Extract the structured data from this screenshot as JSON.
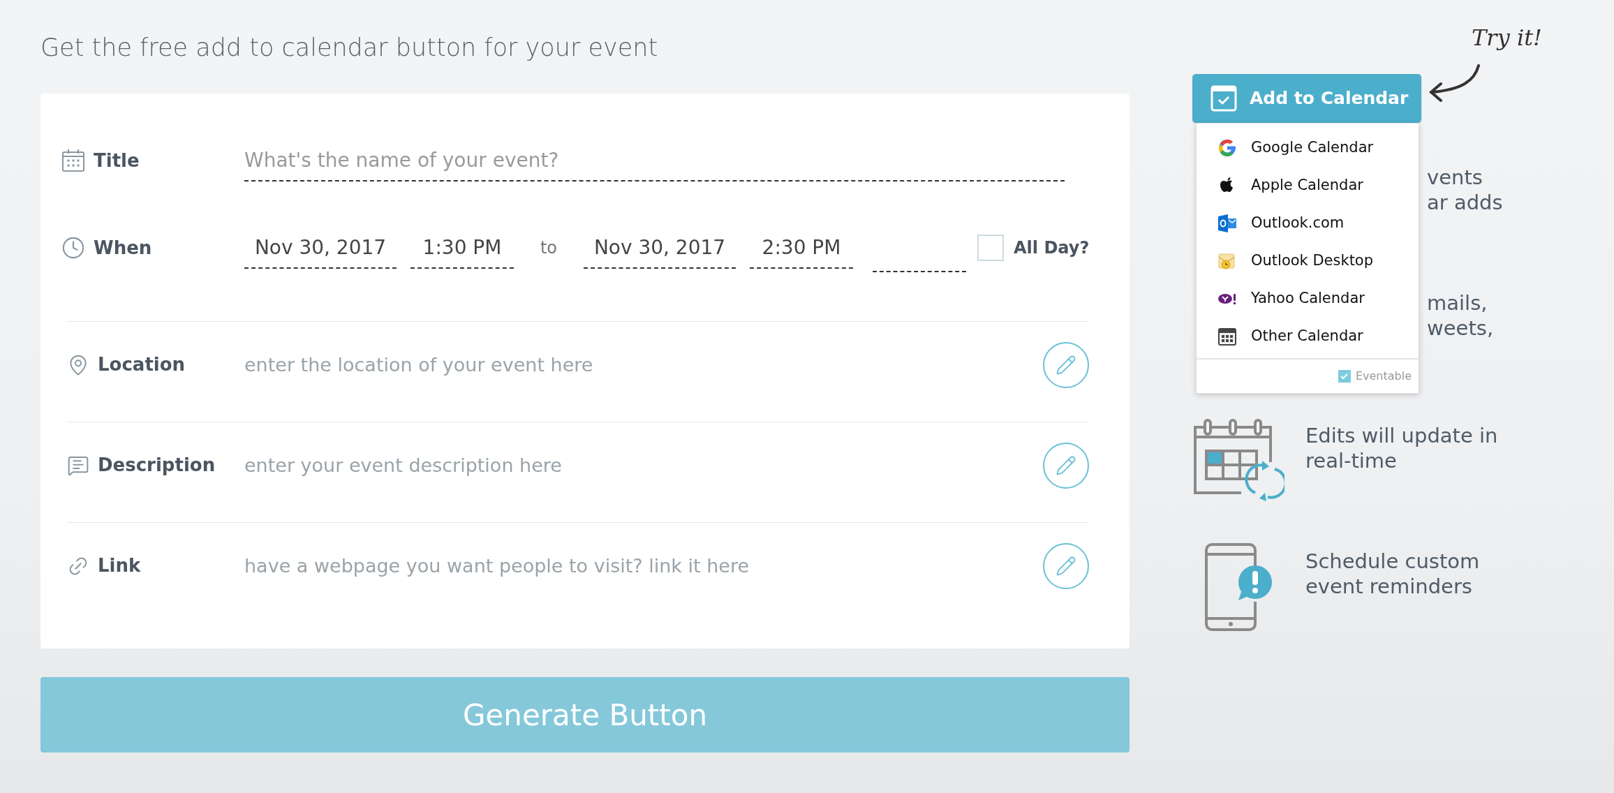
{
  "heading": "Get the free add to calendar button for your event",
  "form": {
    "title": {
      "label": "Title",
      "placeholder": "What's the name of your event?"
    },
    "when": {
      "label": "When",
      "start_date": "Nov 30, 2017",
      "start_time": "1:30 PM",
      "separator": "to",
      "end_date": "Nov 30, 2017",
      "end_time": "2:30 PM",
      "all_day": {
        "label": "All Day?",
        "checked": false
      }
    },
    "rows": [
      {
        "kind": "location",
        "label": "Location",
        "placeholder": "enter the location of your event here"
      },
      {
        "kind": "description",
        "label": "Description",
        "placeholder": "enter your event description here"
      },
      {
        "kind": "link",
        "label": "Link",
        "placeholder": "have a webpage you want people to visit? link it here"
      }
    ]
  },
  "generate_button": "Generate Button",
  "demo": {
    "hint": "Try it!",
    "button": "Add to Calendar",
    "menu": [
      {
        "kind": "google",
        "label": "Google Calendar"
      },
      {
        "kind": "apple",
        "label": "Apple Calendar"
      },
      {
        "kind": "outlook",
        "label": "Outlook.com"
      },
      {
        "kind": "outlook_desktop",
        "label": "Outlook Desktop"
      },
      {
        "kind": "yahoo",
        "label": "Yahoo Calendar"
      },
      {
        "kind": "other",
        "label": "Other Calendar"
      }
    ],
    "footer": "Eventable"
  },
  "features": [
    {
      "kind": "hidden",
      "lines": [
        "vents",
        "ar adds"
      ]
    },
    {
      "kind": "hidden",
      "lines": [
        "mails,",
        "weets,"
      ]
    },
    {
      "kind": "sync",
      "lines": [
        "Edits will update in",
        "real-time"
      ]
    },
    {
      "kind": "reminder",
      "lines": [
        "Schedule custom",
        "event reminders"
      ]
    }
  ]
}
